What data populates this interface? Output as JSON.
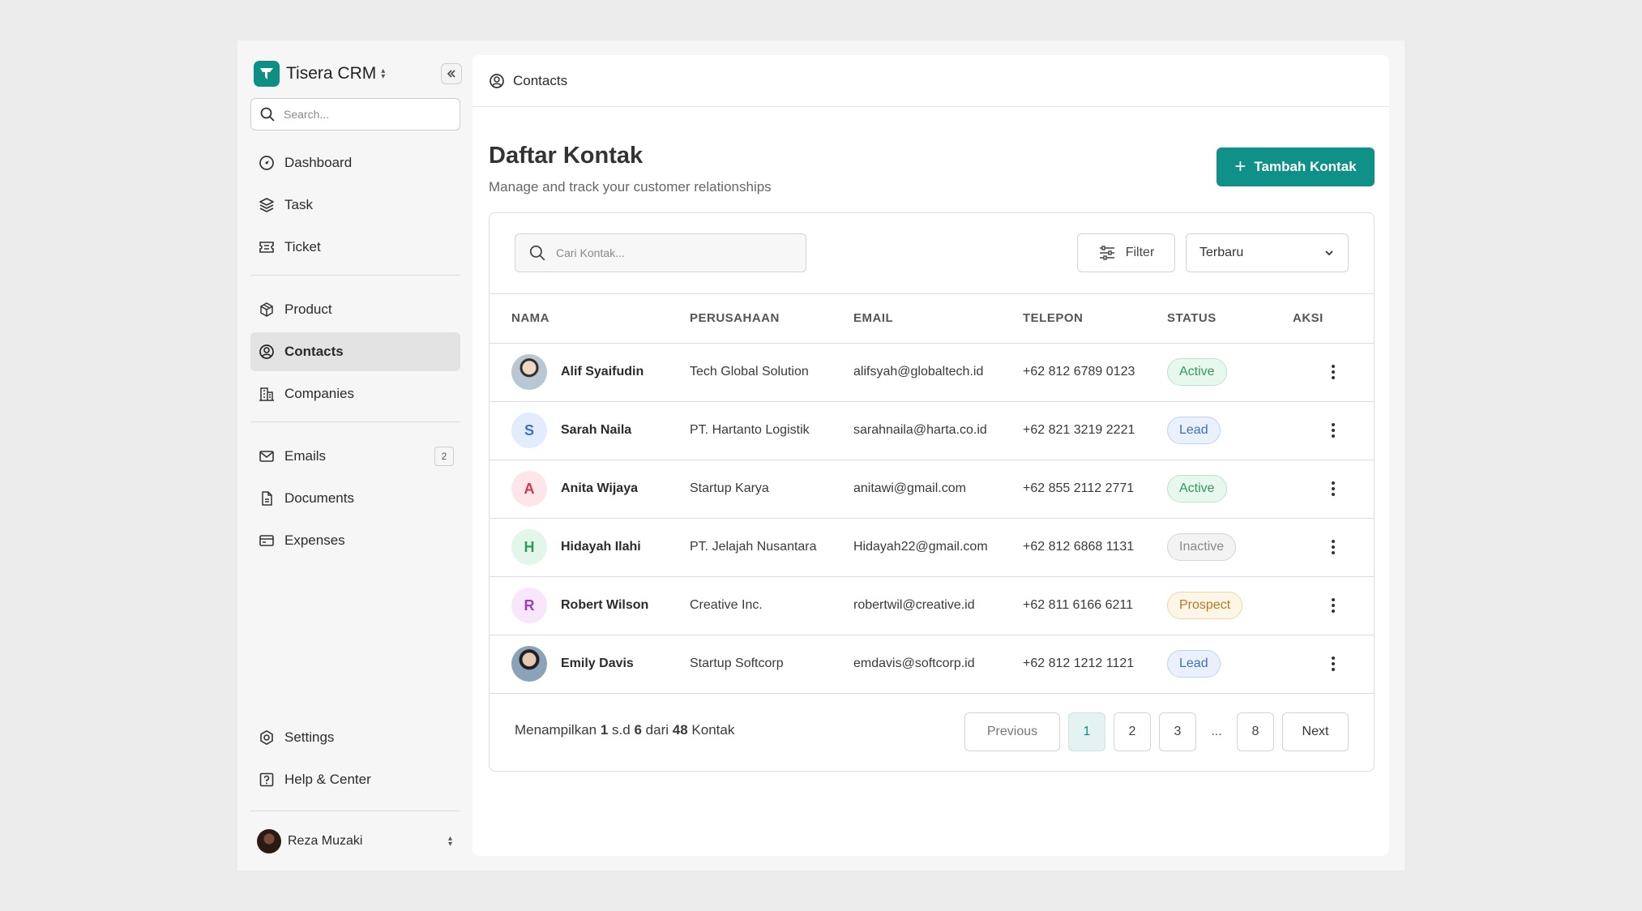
{
  "app": {
    "name": "Tisera CRM",
    "search_placeholder": "Search..."
  },
  "sidebar": {
    "group1": [
      {
        "label": "Dashboard",
        "icon": "dashboard-icon"
      },
      {
        "label": "Task",
        "icon": "layers-icon"
      },
      {
        "label": "Ticket",
        "icon": "ticket-icon"
      }
    ],
    "group2": [
      {
        "label": "Product",
        "icon": "box-icon"
      },
      {
        "label": "Contacts",
        "icon": "user-circle-icon",
        "active": true
      },
      {
        "label": "Companies",
        "icon": "building-icon"
      }
    ],
    "group3": [
      {
        "label": "Emails",
        "icon": "mail-icon",
        "badge": "2"
      },
      {
        "label": "Documents",
        "icon": "document-icon"
      },
      {
        "label": "Expenses",
        "icon": "card-icon"
      }
    ],
    "bottom": [
      {
        "label": "Settings",
        "icon": "gear-icon"
      },
      {
        "label": "Help & Center",
        "icon": "help-icon"
      }
    ],
    "user": {
      "name": "Reza Muzaki"
    }
  },
  "topbar": {
    "title": "Contacts"
  },
  "page": {
    "title": "Daftar Kontak",
    "subtitle": "Manage and track your customer relationships",
    "add_button": "Tambah Kontak"
  },
  "toolbar": {
    "search_placeholder": "Cari Kontak...",
    "filter_label": "Filter",
    "sort_value": "Terbaru"
  },
  "table": {
    "columns": [
      "NAMA",
      "PERUSAHAAN",
      "EMAIL",
      "TELEPON",
      "STATUS",
      "AKSI"
    ],
    "rows": [
      {
        "name": "Alif Syaifudin",
        "initial": "",
        "avatar": "photo1",
        "company": "Tech Global Solution",
        "email": "alifsyah@globaltech.id",
        "phone": "+62 812 6789 0123",
        "status": "Active"
      },
      {
        "name": "Sarah Naila",
        "initial": "S",
        "avatar": "blue",
        "company": "PT. Hartanto Logistik",
        "email": "sarahnaila@harta.co.id",
        "phone": "+62 821 3219 2221",
        "status": "Lead"
      },
      {
        "name": "Anita Wijaya",
        "initial": "A",
        "avatar": "red",
        "company": "Startup Karya",
        "email": "anitawi@gmail.com",
        "phone": "+62 855 2112 2771",
        "status": "Active"
      },
      {
        "name": "Hidayah Ilahi",
        "initial": "H",
        "avatar": "green",
        "company": "PT. Jelajah Nusantara",
        "email": "Hidayah22@gmail.com",
        "phone": "+62 812 6868 1131",
        "status": "Inactive"
      },
      {
        "name": "Robert Wilson",
        "initial": "R",
        "avatar": "purple",
        "company": "Creative Inc.",
        "email": "robertwil@creative.id",
        "phone": "+62 811 6166 6211",
        "status": "Prospect"
      },
      {
        "name": "Emily Davis",
        "initial": "",
        "avatar": "photo2",
        "company": "Startup Softcorp",
        "email": "emdavis@softcorp.id",
        "phone": "+62 812 1212 1121",
        "status": "Lead"
      }
    ]
  },
  "status_colors": {
    "Active": {
      "text": "#2f9a5a",
      "bg": "#e9f8ef",
      "border": "#b9e6c9"
    },
    "Lead": {
      "text": "#3f6fc4",
      "bg": "#eaf1fc",
      "border": "#bfd2f2"
    },
    "Inactive": {
      "text": "#8a8a8a",
      "bg": "#f3f3f3",
      "border": "#d6d6d6"
    },
    "Prospect": {
      "text": "#b7791f",
      "bg": "#fdf5e6",
      "border": "#f1d7a8"
    }
  },
  "avatar_colors": {
    "blue": {
      "bg": "#e3ecfd",
      "fg": "#3f6fc4"
    },
    "red": {
      "bg": "#fde6ea",
      "fg": "#d3344f"
    },
    "green": {
      "bg": "#e3f6ea",
      "fg": "#2f9a5a"
    },
    "purple": {
      "bg": "#f8e6fb",
      "fg": "#a23cc4"
    }
  },
  "pagination": {
    "prefix": "Menampilkan",
    "from": "1",
    "sep": "s.d",
    "to": "6",
    "of_label": "dari",
    "total": "48",
    "suffix": "Kontak",
    "previous": "Previous",
    "next": "Next",
    "pages": [
      "1",
      "2",
      "3"
    ],
    "ellipsis": "...",
    "last_page": "8",
    "current": "1"
  },
  "colors": {
    "accent": "#0f9088"
  }
}
